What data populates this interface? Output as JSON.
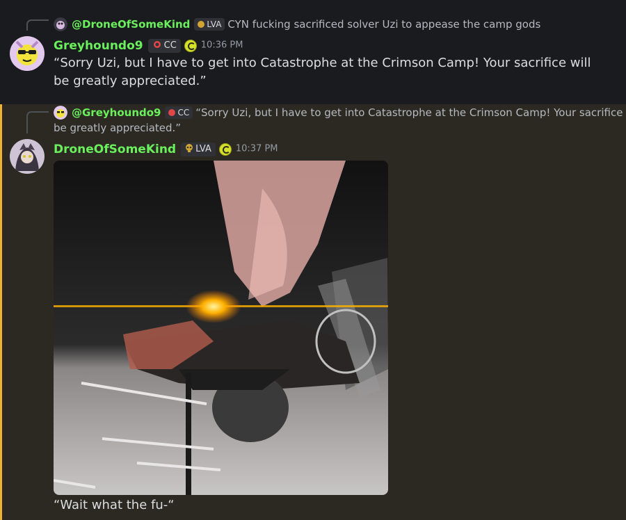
{
  "message1": {
    "reply": {
      "author": "@DroneOfSomeKind",
      "tag": "LVA",
      "text": "CYN fucking sacrificed solver Uzi to appease the camp gods"
    },
    "author": "Greyhoundo9",
    "tag": "CC",
    "time": "10:36 PM",
    "text": "“Sorry Uzi, but I have to get into Catastrophe at the Crimson Camp! Your sacrifice will be greatly appreciated.”"
  },
  "message2": {
    "reply": {
      "author": "@Greyhoundo9",
      "tag": "CC",
      "text_line1": "“Sorry Uzi, but I have to get into Catastrophe at the Crimson Camp! Your sacrifice will",
      "text_line2": "be greatly appreciated.”"
    },
    "author": "DroneOfSomeKind",
    "tag": "LVA",
    "time": "10:37 PM",
    "caption": "“Wait what the fu-“"
  },
  "colors": {
    "username": "#6af05c",
    "highlight_bar": "#f0b232",
    "highlight_bg": "#2b2922",
    "background": "#1a1b1e"
  },
  "icons": [
    "avatar-greyhoundo9",
    "avatar-droneofsomekind",
    "cc-badge-icon",
    "lva-skull-icon",
    "status-icon"
  ]
}
